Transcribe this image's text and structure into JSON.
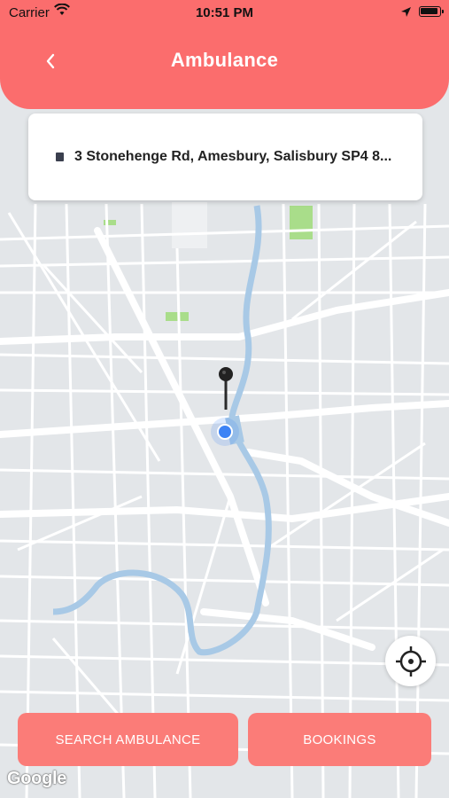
{
  "status_bar": {
    "carrier": "Carrier",
    "time": "10:51 PM"
  },
  "header": {
    "title": "Ambulance"
  },
  "location": {
    "address": "3 Stonehenge Rd, Amesbury, Salisbury SP4 8..."
  },
  "actions": {
    "search_label": "SEARCH AMBULANCE",
    "bookings_label": "BOOKINGS"
  },
  "map": {
    "attribution": "Google",
    "colors": {
      "background": "#e3e6e9",
      "road": "#ffffff",
      "water": "#a8c9e6",
      "park": "#a9dd8a"
    }
  },
  "theme": {
    "accent": "#fb6d6d",
    "button": "#fb7c78",
    "location_dot": "#3d83f5"
  }
}
